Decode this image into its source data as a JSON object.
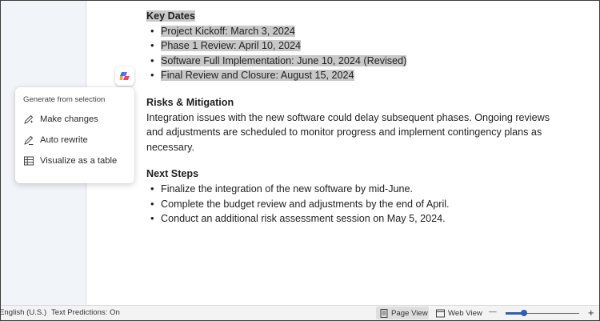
{
  "document": {
    "key_dates": {
      "heading": "Key Dates",
      "items": [
        "Project Kickoff: March 3, 2024",
        "Phase 1 Review: April 10, 2024",
        "Software Full Implementation: June 10, 2024 (Revised)",
        "Final Review and Closure: August 15, 2024"
      ]
    },
    "risks": {
      "heading": "Risks & Mitigation",
      "lines": [
        "Integration issues with the new software could delay subsequent phases. Ongoing reviews",
        "and adjustments are scheduled to monitor progress and implement contingency plans as",
        "necessary."
      ]
    },
    "next_steps": {
      "heading": "Next Steps",
      "items": [
        "Finalize the integration of the new software by mid-June.",
        "Complete the budget review and adjustments by the end of April.",
        "Conduct an additional risk assessment session on May 5, 2024."
      ]
    }
  },
  "menu": {
    "title": "Generate from selection",
    "items": [
      {
        "label": "Make changes",
        "icon": "pen-sparkle-icon"
      },
      {
        "label": "Auto rewrite",
        "icon": "rewrite-icon"
      },
      {
        "label": "Visualize as a table",
        "icon": "table-icon"
      }
    ]
  },
  "statusbar": {
    "language": "English (U.S.)",
    "predictions": "Text Predictions: On",
    "page_view": "Page View",
    "web_view": "Web View",
    "zoom_minus": "—",
    "zoom_plus": "+",
    "zoom_level_fraction": 0.25
  },
  "colors": {
    "highlight": "#c8c8c8",
    "accent": "#2d5fb3"
  }
}
